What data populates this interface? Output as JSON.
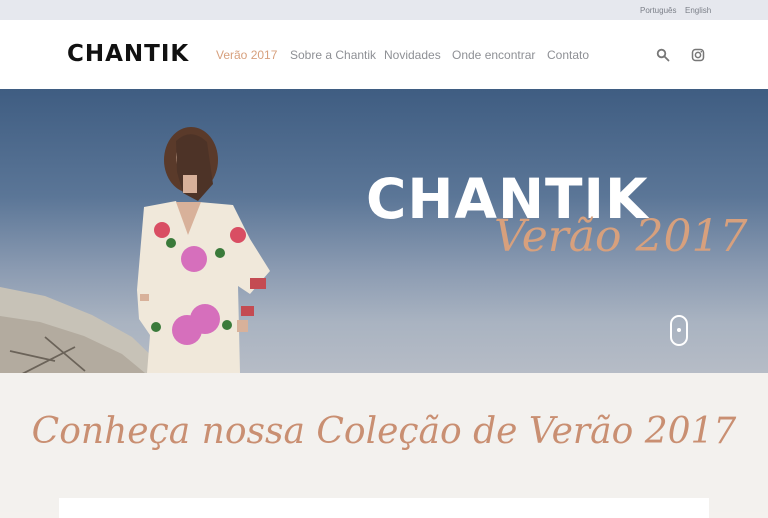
{
  "topbar": {
    "languages": [
      "Português",
      "English"
    ]
  },
  "header": {
    "logo": "CHANTIK",
    "nav": [
      {
        "label": "Verão 2017",
        "active": true
      },
      {
        "label": "Sobre a Chantik",
        "active": false
      },
      {
        "label": "Novidades",
        "active": false
      },
      {
        "label": "Onde encontrar",
        "active": false
      },
      {
        "label": "Contato",
        "active": false
      }
    ],
    "icons": [
      "search-icon",
      "instagram-icon"
    ]
  },
  "hero": {
    "brand": "CHANTIK",
    "script": "Verão 2017"
  },
  "section": {
    "heading": "Conheça nossa Coleção de Verão 2017"
  },
  "colors": {
    "accent": "#d7a07d",
    "hero_blue": "#3f5d82"
  }
}
